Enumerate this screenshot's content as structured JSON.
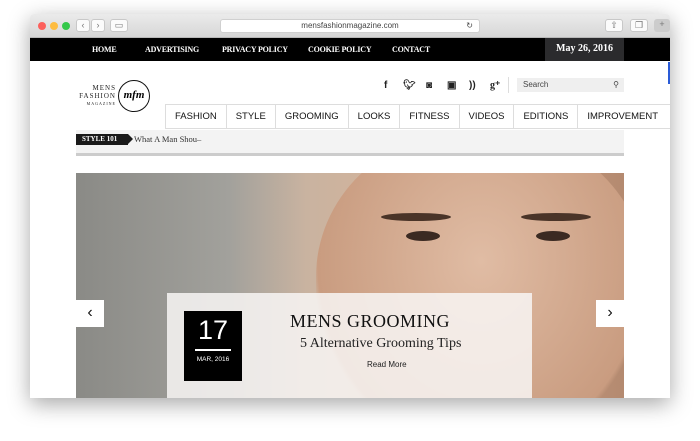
{
  "browser": {
    "url": "mensfashionmagazine.com"
  },
  "topnav": {
    "items": [
      "HOME",
      "ADVERTISING",
      "PRIVACY POLICY",
      "COOKIE POLICY",
      "CONTACT"
    ],
    "date": "May 26, 2016"
  },
  "logo": {
    "line1": "MENS",
    "line2": "FASHION",
    "line3": "MAGAZINE",
    "mark": "mfm"
  },
  "social": [
    "f",
    "t",
    "ig",
    "yt",
    "rss",
    "g+"
  ],
  "search": {
    "placeholder": "Search"
  },
  "menu": [
    "FASHION",
    "STYLE",
    "GROOMING",
    "LOOKS",
    "FITNESS",
    "VIDEOS",
    "EDITIONS",
    "IMPROVEMENT"
  ],
  "ticker": {
    "tag": "STYLE 101",
    "text": "What A Man Shou–"
  },
  "slide": {
    "day": "17",
    "month": "MAR, 2016",
    "title": "MENS GROOMING",
    "subtitle": "5 Alternative Grooming Tips",
    "read_more": "Read More"
  }
}
